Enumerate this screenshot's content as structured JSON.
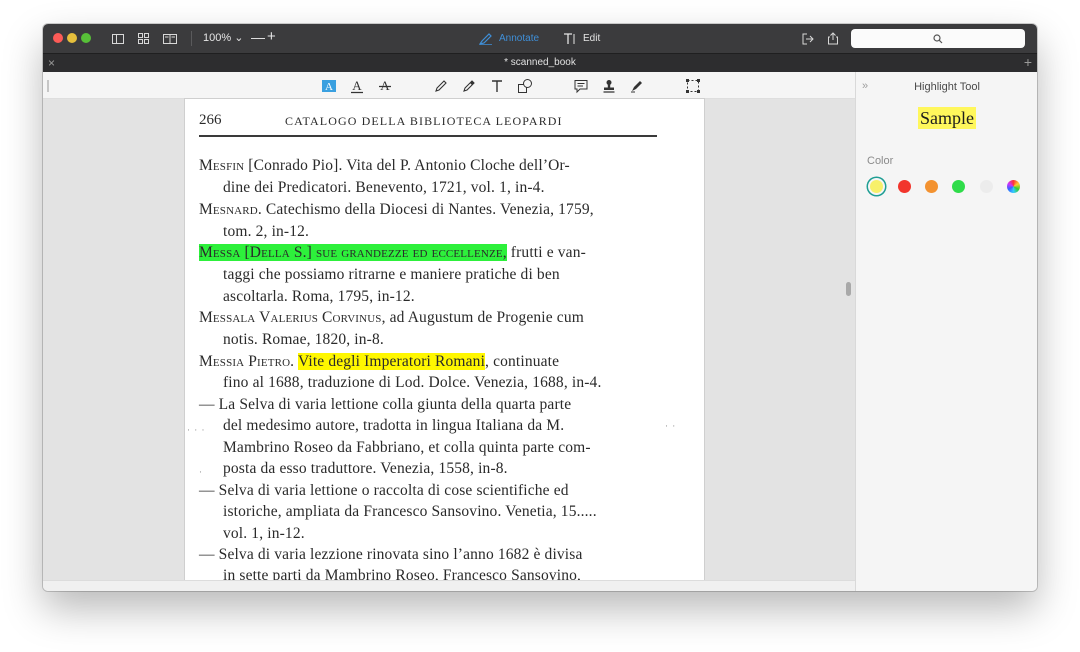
{
  "toolbar": {
    "zoom_label": "100% ⌄",
    "zoom_out_label": "—",
    "zoom_in_label": "+",
    "annotate_label": "Annotate",
    "edit_label": "Edit",
    "search_placeholder": ""
  },
  "tab": {
    "close_label": "×",
    "title": "* scanned_book",
    "add_label": "+"
  },
  "panel": {
    "collapse_label": "»",
    "title": "Highlight Tool",
    "sample_label": "Sample",
    "color_label": "Color",
    "swatches": [
      "#f7f06a",
      "#f2352c",
      "#f39230",
      "#2fdc4a",
      "#ececec"
    ]
  },
  "page": {
    "number": "266",
    "header": "CATALOGO DELLA BIBLIOTECA LEOPARDI",
    "l1_name": "Mesfin",
    "l1_text": " [Conrado Pio]. Vita del P. Antonio Cloche dell’Or-",
    "l2": "dine dei Predicatori. Benevento, 1721, vol. 1, in-4.",
    "l3_name": "Mesnard",
    "l3_text": ". Catechismo della Diocesi di Nantes. Venezia, 1759,",
    "l4": "tom. 2, in-12.",
    "l5_highlight": "Messa [Della S.] sue grandezze ed eccellenze,",
    "l5_text": " frutti e van-",
    "l6": "taggi che possiamo ritrarne e maniere pratiche di ben",
    "l7": "ascoltarla. Roma, 1795, in-12.",
    "l8_name": "Messala Valerius Corvinus",
    "l8_text": ", ad Augustum de Progenie cum",
    "l9": "notis. Romae, 1820, in-8.",
    "l10_name": "Messia Pietro",
    "l10_sep": ". ",
    "l10_highlight": "Vite degli Imperatori Romani",
    "l10_text": ", continuate",
    "l11": "fino al 1688, traduzione di Lod. Dolce. Venezia, 1688, in-4.",
    "l12": "— La Selva di varia lettione colla giunta della quarta parte",
    "l13": "del medesimo autore, tradotta in lingua Italiana da M.",
    "l14": "Mambrino Roseo da Fabbriano, et colla quinta parte com-",
    "l15": "posta da esso traduttore. Venezia, 1558, in-8.",
    "l16": "— Selva di varia lettione o raccolta di cose scientifiche ed",
    "l17": "istoriche, ampliata da Francesco Sansovino. Venetia, 15.....",
    "l18": "vol. 1, in-12.",
    "l19": "— Selva di varia lezzione rinovata sino l’anno 1682 è divisa",
    "l20": "in sette parti da Mambrino Roseo, Francesco Sansovino,"
  }
}
